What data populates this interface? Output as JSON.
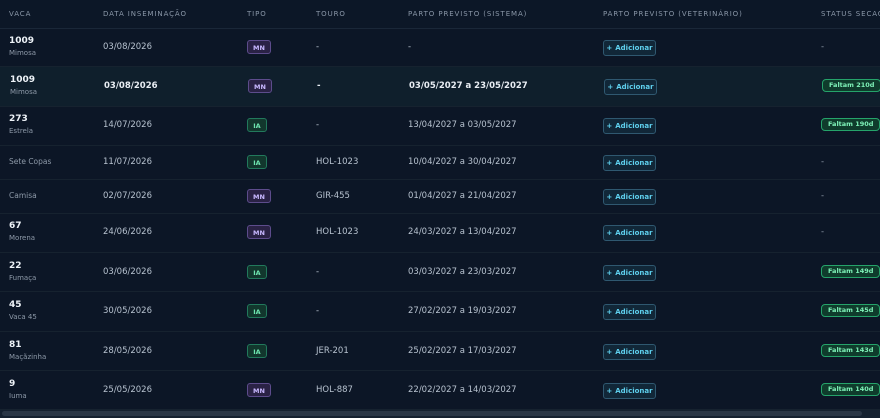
{
  "headers": {
    "vaca": "VACA",
    "data": "DATA INSEMINAÇÃO",
    "tipo": "TIPO",
    "touro": "TOURO",
    "sistema": "PARTO PREVISTO (SISTEMA)",
    "veterinario": "PARTO PREVISTO (VETERINÁRIO)",
    "status": "STATUS SECAGEM"
  },
  "add_label": "Adicionar",
  "rows": [
    {
      "num": "1009",
      "name": "Mimosa",
      "data": "03/08/2026",
      "tipo": "MN",
      "touro": "-",
      "sistema": "-",
      "status": "-"
    },
    {
      "num": "1009",
      "name": "Mimosa",
      "data": "03/08/2026",
      "tipo": "MN",
      "touro": "-",
      "sistema": "03/05/2027 a 23/05/2027",
      "status": "Faltam 210d"
    },
    {
      "num": "273",
      "name": "Estrela",
      "data": "14/07/2026",
      "tipo": "IA",
      "touro": "-",
      "sistema": "13/04/2027 a 03/05/2027",
      "status": "Faltam 190d"
    },
    {
      "num": "",
      "name": "Sete Copas",
      "data": "11/07/2026",
      "tipo": "IA",
      "touro": "HOL-1023",
      "sistema": "10/04/2027 a 30/04/2027",
      "status": "-"
    },
    {
      "num": "",
      "name": "Camisa",
      "data": "02/07/2026",
      "tipo": "MN",
      "touro": "GIR-455",
      "sistema": "01/04/2027 a 21/04/2027",
      "status": "-"
    },
    {
      "num": "67",
      "name": "Morena",
      "data": "24/06/2026",
      "tipo": "MN",
      "touro": "HOL-1023",
      "sistema": "24/03/2027 a 13/04/2027",
      "status": "-"
    },
    {
      "num": "22",
      "name": "Fumaça",
      "data": "03/06/2026",
      "tipo": "IA",
      "touro": "-",
      "sistema": "03/03/2027 a 23/03/2027",
      "status": "Faltam 149d"
    },
    {
      "num": "45",
      "name": "Vaca 45",
      "data": "30/05/2026",
      "tipo": "IA",
      "touro": "-",
      "sistema": "27/02/2027 a 19/03/2027",
      "status": "Faltam 145d"
    },
    {
      "num": "81",
      "name": "Maçãzinha",
      "data": "28/05/2026",
      "tipo": "IA",
      "touro": "JER-201",
      "sistema": "25/02/2027 a 17/03/2027",
      "status": "Faltam 143d"
    },
    {
      "num": "9",
      "name": "Iuma",
      "data": "25/05/2026",
      "tipo": "MN",
      "touro": "HOL-887",
      "sistema": "22/02/2027 a 14/03/2027",
      "status": "Faltam 140d"
    }
  ]
}
